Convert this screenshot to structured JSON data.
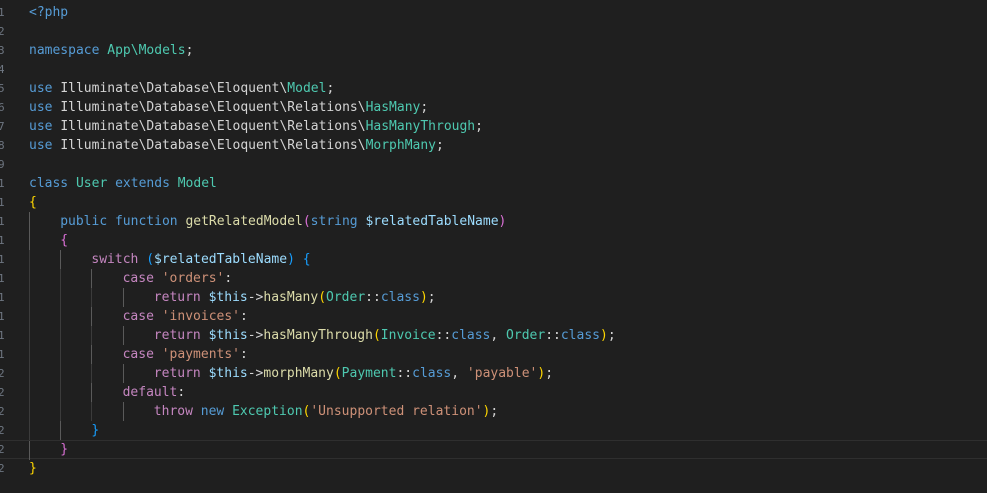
{
  "editor": {
    "language": "php",
    "current_line": 24,
    "lines": [
      {
        "tokens": [
          {
            "t": "<?php",
            "c": "kw"
          }
        ]
      },
      {
        "tokens": []
      },
      {
        "tokens": [
          {
            "t": "namespace ",
            "c": "kw"
          },
          {
            "t": "App\\Models",
            "c": "tp"
          },
          {
            "t": ";",
            "c": "txt"
          }
        ]
      },
      {
        "tokens": []
      },
      {
        "tokens": [
          {
            "t": "use ",
            "c": "kw"
          },
          {
            "t": "Illuminate\\Database\\Eloquent\\",
            "c": "txt"
          },
          {
            "t": "Model",
            "c": "tp"
          },
          {
            "t": ";",
            "c": "txt"
          }
        ]
      },
      {
        "tokens": [
          {
            "t": "use ",
            "c": "kw"
          },
          {
            "t": "Illuminate\\Database\\Eloquent\\Relations\\",
            "c": "txt"
          },
          {
            "t": "HasMany",
            "c": "tp"
          },
          {
            "t": ";",
            "c": "txt"
          }
        ]
      },
      {
        "tokens": [
          {
            "t": "use ",
            "c": "kw"
          },
          {
            "t": "Illuminate\\Database\\Eloquent\\Relations\\",
            "c": "txt"
          },
          {
            "t": "HasManyThrough",
            "c": "tp"
          },
          {
            "t": ";",
            "c": "txt"
          }
        ]
      },
      {
        "tokens": [
          {
            "t": "use ",
            "c": "kw"
          },
          {
            "t": "Illuminate\\Database\\Eloquent\\Relations\\",
            "c": "txt"
          },
          {
            "t": "MorphMany",
            "c": "tp"
          },
          {
            "t": ";",
            "c": "txt"
          }
        ]
      },
      {
        "tokens": []
      },
      {
        "tokens": [
          {
            "t": "class ",
            "c": "kw"
          },
          {
            "t": "User ",
            "c": "tp"
          },
          {
            "t": "extends ",
            "c": "kw"
          },
          {
            "t": "Model",
            "c": "tp"
          }
        ]
      },
      {
        "tokens": [
          {
            "t": "{",
            "c": "b1"
          }
        ]
      },
      {
        "indent": 1,
        "tokens": [
          {
            "t": "public ",
            "c": "kw"
          },
          {
            "t": "function ",
            "c": "kw"
          },
          {
            "t": "getRelatedModel",
            "c": "fn"
          },
          {
            "t": "(",
            "c": "b2"
          },
          {
            "t": "string ",
            "c": "kw"
          },
          {
            "t": "$relatedTableName",
            "c": "var"
          },
          {
            "t": ")",
            "c": "b2"
          }
        ]
      },
      {
        "indent": 1,
        "tokens": [
          {
            "t": "{",
            "c": "b2"
          }
        ]
      },
      {
        "indent": 2,
        "tokens": [
          {
            "t": "switch ",
            "c": "ctl"
          },
          {
            "t": "(",
            "c": "b3"
          },
          {
            "t": "$relatedTableName",
            "c": "var"
          },
          {
            "t": ") ",
            "c": "b3"
          },
          {
            "t": "{",
            "c": "b3"
          }
        ]
      },
      {
        "indent": 3,
        "tokens": [
          {
            "t": "case ",
            "c": "ctl"
          },
          {
            "t": "'orders'",
            "c": "str"
          },
          {
            "t": ":",
            "c": "txt"
          }
        ]
      },
      {
        "indent": 4,
        "tokens": [
          {
            "t": "return ",
            "c": "ctl"
          },
          {
            "t": "$this",
            "c": "var"
          },
          {
            "t": "->",
            "c": "txt"
          },
          {
            "t": "hasMany",
            "c": "fn"
          },
          {
            "t": "(",
            "c": "b1"
          },
          {
            "t": "Order",
            "c": "tp"
          },
          {
            "t": "::",
            "c": "txt"
          },
          {
            "t": "class",
            "c": "kw"
          },
          {
            "t": ")",
            "c": "b1"
          },
          {
            "t": ";",
            "c": "txt"
          }
        ]
      },
      {
        "indent": 3,
        "tokens": [
          {
            "t": "case ",
            "c": "ctl"
          },
          {
            "t": "'invoices'",
            "c": "str"
          },
          {
            "t": ":",
            "c": "txt"
          }
        ]
      },
      {
        "indent": 4,
        "tokens": [
          {
            "t": "return ",
            "c": "ctl"
          },
          {
            "t": "$this",
            "c": "var"
          },
          {
            "t": "->",
            "c": "txt"
          },
          {
            "t": "hasManyThrough",
            "c": "fn"
          },
          {
            "t": "(",
            "c": "b1"
          },
          {
            "t": "Invoice",
            "c": "tp"
          },
          {
            "t": "::",
            "c": "txt"
          },
          {
            "t": "class",
            "c": "kw"
          },
          {
            "t": ", ",
            "c": "txt"
          },
          {
            "t": "Order",
            "c": "tp"
          },
          {
            "t": "::",
            "c": "txt"
          },
          {
            "t": "class",
            "c": "kw"
          },
          {
            "t": ")",
            "c": "b1"
          },
          {
            "t": ";",
            "c": "txt"
          }
        ]
      },
      {
        "indent": 3,
        "tokens": [
          {
            "t": "case ",
            "c": "ctl"
          },
          {
            "t": "'payments'",
            "c": "str"
          },
          {
            "t": ":",
            "c": "txt"
          }
        ]
      },
      {
        "indent": 4,
        "tokens": [
          {
            "t": "return ",
            "c": "ctl"
          },
          {
            "t": "$this",
            "c": "var"
          },
          {
            "t": "->",
            "c": "txt"
          },
          {
            "t": "morphMany",
            "c": "fn"
          },
          {
            "t": "(",
            "c": "b1"
          },
          {
            "t": "Payment",
            "c": "tp"
          },
          {
            "t": "::",
            "c": "txt"
          },
          {
            "t": "class",
            "c": "kw"
          },
          {
            "t": ", ",
            "c": "txt"
          },
          {
            "t": "'payable'",
            "c": "str"
          },
          {
            "t": ")",
            "c": "b1"
          },
          {
            "t": ";",
            "c": "txt"
          }
        ]
      },
      {
        "indent": 3,
        "tokens": [
          {
            "t": "default",
            "c": "ctl"
          },
          {
            "t": ":",
            "c": "txt"
          }
        ]
      },
      {
        "indent": 4,
        "tokens": [
          {
            "t": "throw ",
            "c": "ctl"
          },
          {
            "t": "new ",
            "c": "kw"
          },
          {
            "t": "Exception",
            "c": "tp"
          },
          {
            "t": "(",
            "c": "b1"
          },
          {
            "t": "'Unsupported relation'",
            "c": "str"
          },
          {
            "t": ")",
            "c": "b1"
          },
          {
            "t": ";",
            "c": "txt"
          }
        ]
      },
      {
        "indent": 2,
        "tokens": [
          {
            "t": "}",
            "c": "b3"
          }
        ]
      },
      {
        "indent": 1,
        "tokens": [
          {
            "t": "}",
            "c": "b2"
          }
        ]
      },
      {
        "tokens": [
          {
            "t": "}",
            "c": "b1"
          }
        ]
      }
    ]
  },
  "colors": {
    "background": "#1f1f1f",
    "keyword": "#569cd6",
    "control": "#c586c0",
    "type": "#4ec9b0",
    "function": "#dcdcaa",
    "variable": "#9cdcfe",
    "string": "#ce9178",
    "text": "#d4d4d4",
    "bracket_1": "#ffd700",
    "bracket_2": "#da70d6",
    "bracket_3": "#179fff"
  }
}
